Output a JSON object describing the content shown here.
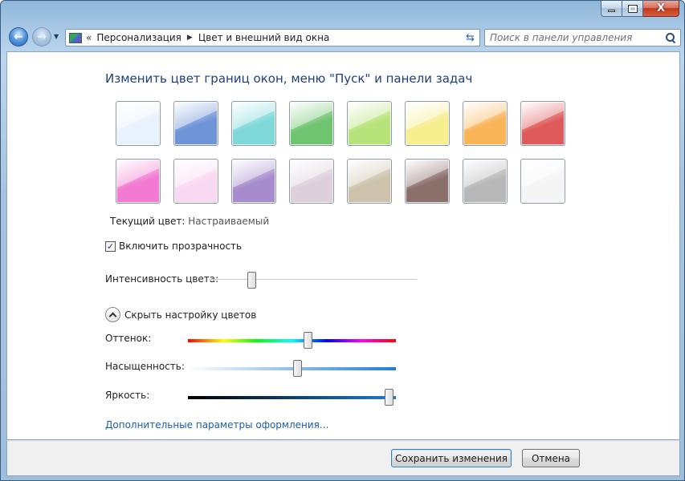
{
  "window": {
    "close_glyph": "X"
  },
  "address": {
    "prefix": "«",
    "segments": [
      "Персонализация",
      "Цвет и внешний вид окна"
    ],
    "separator": "▶"
  },
  "search": {
    "placeholder": "Поиск в панели управления"
  },
  "heading": "Изменить цвет границ окон, меню \"Пуск\" и панели задач",
  "swatches": [
    {
      "color": "#e8f2fd"
    },
    {
      "color": "#6e93d6"
    },
    {
      "color": "#7fd8d8"
    },
    {
      "color": "#6fc46f"
    },
    {
      "color": "#b8e37a"
    },
    {
      "color": "#f7ee8e"
    },
    {
      "color": "#f9b457"
    },
    {
      "color": "#df5a5a"
    },
    {
      "color": "#f27ad0"
    },
    {
      "color": "#f9d9f2"
    },
    {
      "color": "#a68ccc"
    },
    {
      "color": "#ddd0dc"
    },
    {
      "color": "#cdc3ad"
    },
    {
      "color": "#8b6f6a"
    },
    {
      "color": "#b8b8b8"
    },
    {
      "color": "#f5f5f5"
    }
  ],
  "current_color": {
    "label": "Текущий цвет:",
    "value": "Настраиваемый"
  },
  "transparency": {
    "label": "Включить прозрачность",
    "checked": true,
    "check_glyph": "✓"
  },
  "intensity": {
    "label": "Интенсивность цвета:",
    "value_fraction": 0.21
  },
  "toggle": {
    "label": "Скрыть настройку цветов"
  },
  "hue": {
    "label": "Оттенок:",
    "value_fraction": 0.58
  },
  "saturation": {
    "label": "Насыщенность:",
    "value_fraction": 0.53
  },
  "brightness": {
    "label": "Яркость:",
    "value_fraction": 0.97
  },
  "advanced_link": "Дополнительные параметры оформления...",
  "buttons": {
    "save": "Сохранить изменения",
    "cancel": "Отмена"
  }
}
